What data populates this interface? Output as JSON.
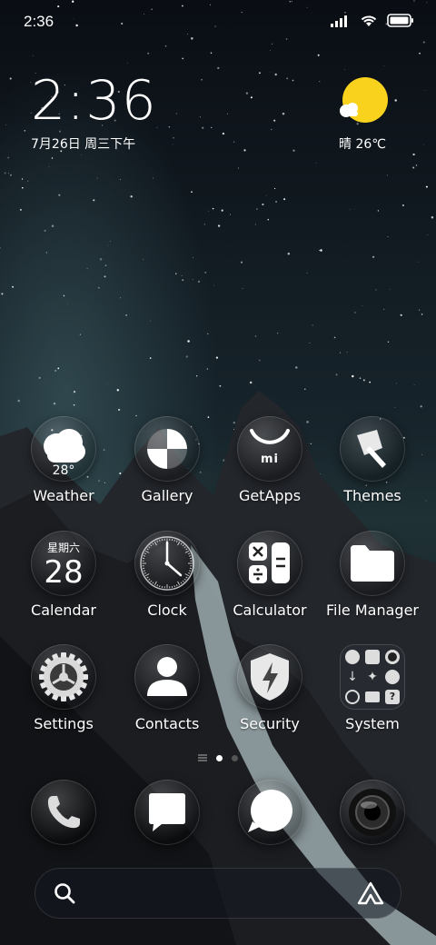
{
  "status_bar": {
    "time": "2:36"
  },
  "clock_widget": {
    "time": "2:36",
    "date": "7月26日 周三下午"
  },
  "weather_widget": {
    "text": "晴 26℃"
  },
  "apps": {
    "weather": {
      "label": "Weather",
      "temp": "28°"
    },
    "gallery": {
      "label": "Gallery"
    },
    "getapps": {
      "label": "GetApps",
      "logo": "mi"
    },
    "themes": {
      "label": "Themes"
    },
    "calendar": {
      "label": "Calendar",
      "weekday": "星期六",
      "day": "28"
    },
    "clock": {
      "label": "Clock"
    },
    "calculator": {
      "label": "Calculator"
    },
    "file_manager": {
      "label": "File Manager"
    },
    "settings": {
      "label": "Settings"
    },
    "contacts": {
      "label": "Contacts"
    },
    "security": {
      "label": "Security"
    },
    "system": {
      "label": "System"
    }
  },
  "page_indicator": {
    "current": 1,
    "total": 2
  },
  "dock": [
    "phone-icon",
    "messages-icon",
    "browser-icon",
    "camera-icon"
  ],
  "search_bar": {
    "left_icon": "search-icon",
    "right_icon": "assistant-icon"
  },
  "colors": {
    "weather_sun": "#f8d21c",
    "wallpaper_sky": "#0b1017",
    "mountain": "#2a2d33"
  }
}
